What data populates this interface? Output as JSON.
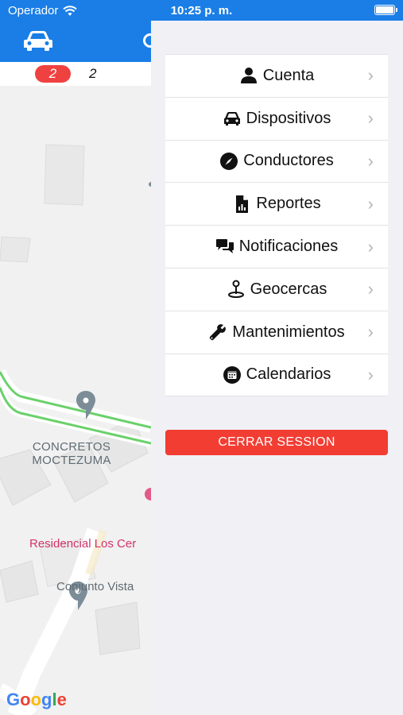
{
  "status_bar": {
    "carrier": "Operador",
    "time": "10:25 p. m."
  },
  "map_header": {
    "active_tab_icon": "car-icon"
  },
  "counters": {
    "alert_count": "2",
    "device_count": "2"
  },
  "map": {
    "poi_1_line1": "CONCRETOS",
    "poi_1_line2": "MOCTEZUMA",
    "poi_2": "Residencial Los Cer",
    "poi_3": "Conjunto Vista ",
    "logo": "Google"
  },
  "menu": {
    "items": [
      {
        "label": "Cuenta",
        "icon": "person-icon"
      },
      {
        "label": "Dispositivos",
        "icon": "car-icon"
      },
      {
        "label": "Conductores",
        "icon": "compass-icon"
      },
      {
        "label": "Reportes",
        "icon": "report-icon"
      },
      {
        "label": "Notificaciones",
        "icon": "chat-icon"
      },
      {
        "label": "Geocercas",
        "icon": "map-pin-icon"
      },
      {
        "label": "Mantenimientos",
        "icon": "wrench-icon"
      },
      {
        "label": "Calendarios",
        "icon": "calendar-icon"
      }
    ],
    "logout_label": "CERRAR SESSION"
  },
  "colors": {
    "primary": "#1a7ee6",
    "danger": "#f23d33",
    "badge": "#f04141"
  }
}
